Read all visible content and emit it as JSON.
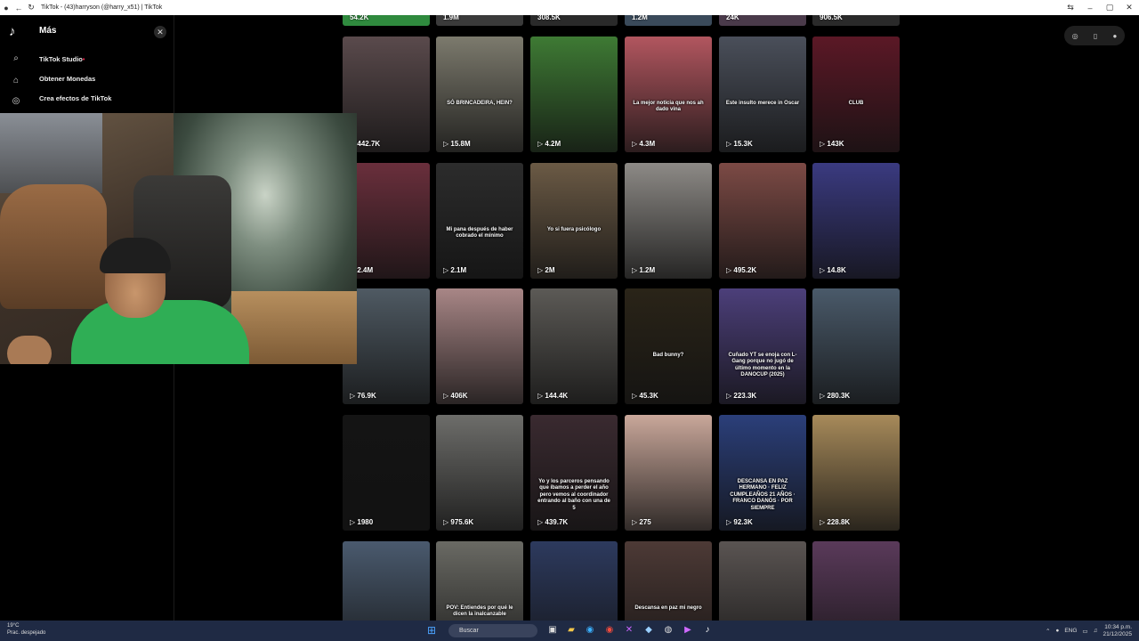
{
  "window": {
    "title": "TikTok - (43)harryson (@harry_x51) | TikTok"
  },
  "sidebar": {
    "panel_title": "Más",
    "items": [
      {
        "label": "TikTok Studio"
      },
      {
        "label": "Obtener Monedas"
      },
      {
        "label": "Crea efectos de TikTok"
      }
    ]
  },
  "grid": {
    "top_row_views": [
      "54.2K",
      "1.9M",
      "308.5K",
      "1.2M",
      "24K",
      "906.5K"
    ],
    "rows": [
      [
        {
          "views": "442.7K",
          "caption": "",
          "color": "#5a4a4c"
        },
        {
          "views": "15.8M",
          "caption": "SÓ BRINCADEIRA, HEIN?",
          "color": "#7c7a6d"
        },
        {
          "views": "4.2M",
          "caption": "",
          "color": "#3e7a34"
        },
        {
          "views": "4.3M",
          "caption": "La mejor noticia que nos ah dado vina",
          "color": "#b2565f"
        },
        {
          "views": "15.3K",
          "caption": "Este insulto merece in Oscar",
          "color": "#4a4f5a"
        },
        {
          "views": "143K",
          "caption": "CLUB",
          "color": "#5b1826"
        }
      ],
      [
        {
          "views": "2.4M",
          "caption": "",
          "color": "#6a2f3c"
        },
        {
          "views": "2.1M",
          "caption": "Mi pana después de haber cobrado el mínimo",
          "color": "#2c2c2c"
        },
        {
          "views": "2M",
          "caption": "Yo si fuera psicólogo",
          "color": "#6b5a45"
        },
        {
          "views": "1.2M",
          "caption": "",
          "color": "#8d8a86"
        },
        {
          "views": "495.2K",
          "caption": "",
          "color": "#7c4a45"
        },
        {
          "views": "14.8K",
          "caption": "",
          "color": "#3a3a80"
        }
      ],
      [
        {
          "views": "76.9K",
          "caption": "",
          "color": "#4f5a63"
        },
        {
          "views": "406K",
          "caption": "",
          "color": "#a88686"
        },
        {
          "views": "144.4K",
          "caption": "",
          "color": "#5c5a56"
        },
        {
          "views": "45.3K",
          "caption": "Bad bunny?",
          "color": "#2a2418"
        },
        {
          "views": "223.3K",
          "caption": "Cuñado YT se enoja con L-Gang porque no jugó de último momento en la DANOCUP (2025)",
          "color": "#4c3f7a"
        },
        {
          "views": "280.3K",
          "caption": "",
          "color": "#4a5a6a"
        }
      ],
      [
        {
          "views": "1980",
          "caption": "",
          "color": "#141414"
        },
        {
          "views": "975.6K",
          "caption": "",
          "color": "#6d6d6a"
        },
        {
          "views": "439.7K",
          "caption": "Yo y los parceros pensando que íbamos a perder el año pero vemos al coordinador entrando al baño con una de 5",
          "color": "#3a2a30"
        },
        {
          "views": "275",
          "caption": "",
          "color": "#c9a79a"
        },
        {
          "views": "92.3K",
          "caption": "DESCANSA EN PAZ HERMANO · FELIZ CUMPLEAÑOS 21 AÑOS · FRANCO DANÓS · POR SIEMPRE",
          "color": "#2b3f7a"
        },
        {
          "views": "228.8K",
          "caption": "",
          "color": "#a78a5a"
        }
      ],
      [
        {
          "views": "",
          "caption": "",
          "color": "#4a5a6e"
        },
        {
          "views": "",
          "caption": "POV: Entiendes por qué le dicen la inalcanzable",
          "color": "#6a6a64"
        },
        {
          "views": "",
          "caption": "",
          "color": "#2d3a5e"
        },
        {
          "views": "",
          "caption": "Descansa en paz mi negro",
          "color": "#4d3a36"
        },
        {
          "views": "",
          "caption": "",
          "color": "#5a5452"
        },
        {
          "views": "",
          "caption": "",
          "color": "#5a3a5a"
        }
      ]
    ]
  },
  "taskbar": {
    "weather_temp": "19°C",
    "weather_desc": "Prac. despejado",
    "search_placeholder": "Buscar",
    "language": "ENG",
    "time": "10:34 p.m.",
    "date": "21/12/2025"
  }
}
